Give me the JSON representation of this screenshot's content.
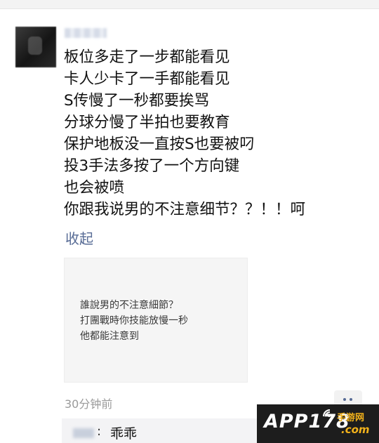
{
  "post": {
    "lines": [
      "板位多走了一步都能看见",
      "卡人少卡了一手都能看见",
      "S传慢了一秒都要挨骂",
      "分球分慢了半拍也要教育",
      "保护地板没一直按S也要被叼",
      "投3手法多按了一个方向键",
      "也会被喷",
      "你跟我说男的不注意细节？？！！呵"
    ],
    "collapse_label": "收起"
  },
  "image": {
    "lines": [
      "誰說男的不注意細節？",
      "打團戰時你技能放慢一秒",
      "他都能注意到"
    ]
  },
  "meta": {
    "time": "30分钟前"
  },
  "comment": {
    "colon": ":",
    "text": "乖乖"
  },
  "watermark": {
    "logo": "APP178",
    "sub_a": "手游网",
    "sub_b": ".com"
  },
  "colors": {
    "link": "#576b95",
    "watermark_bg": "#1d1d1d",
    "watermark_accent": "#f2b21b"
  },
  "icons": {
    "more": "more-dots-icon",
    "signal": "signal-icon"
  }
}
